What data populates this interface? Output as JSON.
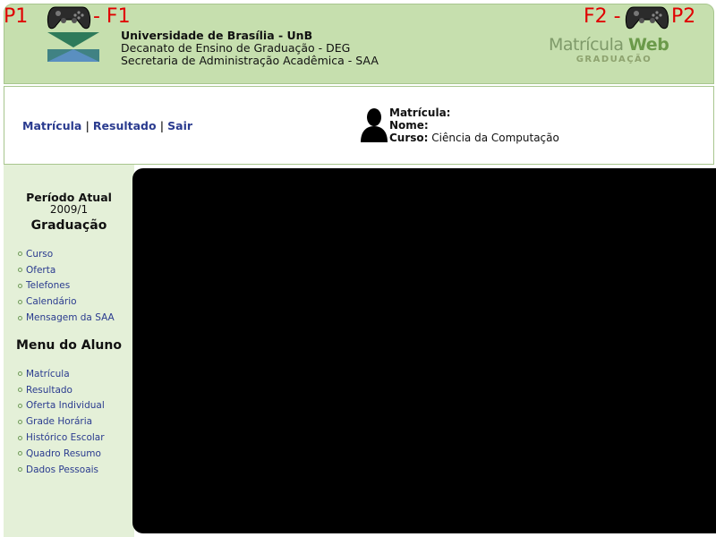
{
  "overlay": {
    "left_label": "P1",
    "left_key": "- F1",
    "right_key": "F2 -",
    "right_label": "P2"
  },
  "header": {
    "institution": "Universidade de Brasília - UnB",
    "department": "Decanato de Ensino de Graduação - DEG",
    "secretariat": "Secretaria de Administração Acadêmica - SAA",
    "app_title_part1": "Matrícula ",
    "app_title_part2": "Web",
    "app_subtitle": "GRADUAÇÃO"
  },
  "topnav": {
    "items": [
      "Matrícula",
      "Resultado",
      "Sair"
    ],
    "separator": "|"
  },
  "student": {
    "matricula_label": "Matrícula:",
    "matricula_value": "",
    "nome_label": "Nome:",
    "nome_value": "",
    "curso_label": "Curso:",
    "curso_value": "Ciência da Computação"
  },
  "sidebar": {
    "periodo_label": "Período Atual",
    "periodo_value": "2009/1",
    "graduacao_title": "Graduação",
    "graduacao_items": [
      "Curso",
      "Oferta",
      "Telefones",
      "Calendário",
      "Mensagem da SAA"
    ],
    "menu_title": "Menu do Aluno",
    "menu_items": [
      "Matrícula",
      "Resultado",
      "Oferta Individual",
      "Grade Horária",
      "Histórico Escolar",
      "Quadro Resumo",
      "Dados Pessoais"
    ]
  },
  "colors": {
    "header_bg": "#c6dfae",
    "sidebar_bg": "#e4f0d8",
    "link": "#2a3b8f",
    "overlay_red": "#e00000"
  }
}
